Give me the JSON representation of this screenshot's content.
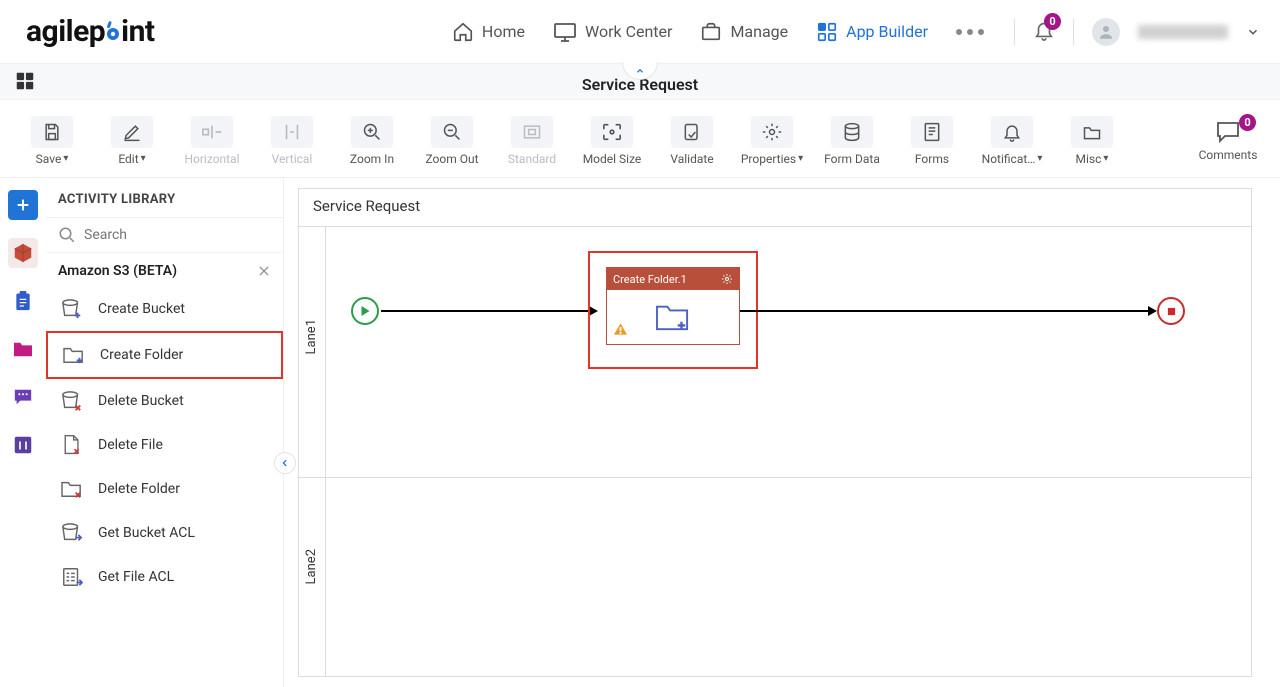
{
  "nav": {
    "home": "Home",
    "work_center": "Work Center",
    "manage": "Manage",
    "app_builder": "App Builder",
    "notif_count": "0"
  },
  "subheader": {
    "title": "Service Request"
  },
  "toolbar": {
    "save": "Save",
    "edit": "Edit",
    "horizontal": "Horizontal",
    "vertical": "Vertical",
    "zoom_in": "Zoom In",
    "zoom_out": "Zoom Out",
    "standard": "Standard",
    "model_size": "Model Size",
    "validate": "Validate",
    "properties": "Properties",
    "form_data": "Form Data",
    "forms": "Forms",
    "notifications": "Notificat…",
    "misc": "Misc",
    "comments": "Comments",
    "comments_count": "0"
  },
  "library": {
    "title": "ACTIVITY LIBRARY",
    "search_placeholder": "Search",
    "group": "Amazon S3 (BETA)",
    "items": [
      "Create Bucket",
      "Create Folder",
      "Delete Bucket",
      "Delete File",
      "Delete Folder",
      "Get Bucket ACL",
      "Get File ACL"
    ]
  },
  "canvas": {
    "title": "Service Request",
    "lane1": "Lane1",
    "lane2": "Lane2",
    "activity_label": "Create Folder.1"
  }
}
